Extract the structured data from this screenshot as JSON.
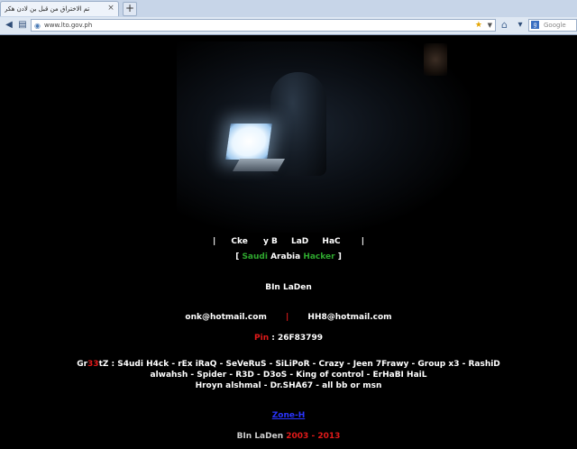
{
  "browser": {
    "tab_title": "تم الاختراق من قبل بن لادن هكر",
    "tab_close": "×",
    "new_tab": "+",
    "url": "www.lto.gov.ph",
    "search_placeholder": "Google"
  },
  "page": {
    "title_line": [
      "|",
      "Cke",
      "y B",
      "LaD",
      "HaC",
      "|"
    ],
    "subtitle": {
      "open": "[",
      "saudi": "Saudi",
      "arabia": "Arabia",
      "hacker": "Hacker",
      "close": "]"
    },
    "name": "BIn LaDen",
    "emails": [
      "onk@hotmail.com",
      "|",
      "HH8@hotmail.com"
    ],
    "pin_label": "Pin",
    "pin_value": ": 26F83799",
    "greets_prefix_a": "Gr",
    "greets_prefix_b": "33",
    "greets_prefix_c": "tZ :",
    "greets_line1": "S4udi H4ck  -  rEx iRaQ  -  SeVeRuS  -  SiLiPoR  -  Crazy  -  Jeen 7Frawy  -  Group x3  -  RashiD",
    "greets_line2": "alwahsh  -  Spider - R3D - D3oS - King of control - ErHaBI HaiL",
    "greets_line3": "Hroyn alshmal - Dr.SHA67 - all bb or msn",
    "zone_link": "Zone-H",
    "footer_name": "BIn LaDen",
    "footer_year1": "2003",
    "footer_dash": "-",
    "footer_year2": "2013"
  },
  "colors": {
    "background": "#000000",
    "green": "#2ea82e",
    "red": "#e21a1a",
    "link": "#2a35ff"
  }
}
